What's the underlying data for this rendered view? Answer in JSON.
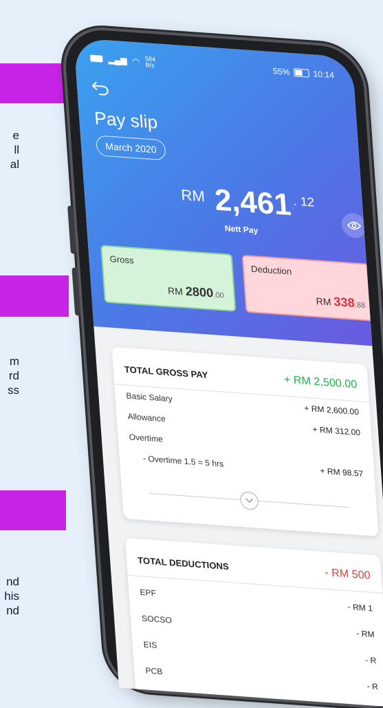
{
  "phone": {
    "status": {
      "speed_top": "584",
      "speed_bottom": "B/s",
      "battery": "55%",
      "time": "10:14"
    },
    "header": {
      "title": "Pay slip",
      "month": "March 2020"
    },
    "nett": {
      "currency": "RM",
      "whole": "2,461",
      "cents": ". 12",
      "label": "Nett Pay"
    },
    "gross_card": {
      "label": "Gross",
      "currency": "RM",
      "whole": "2800",
      "cents": ".00"
    },
    "deduction_card": {
      "label": "Deduction",
      "currency": "RM",
      "whole": "338",
      "cents": ".88"
    },
    "gross_panel": {
      "title": "TOTAL GROSS PAY",
      "total": "+ RM 2,500.00",
      "rows": [
        {
          "label": "Basic Salary",
          "amount": "+ RM 2,600.00"
        },
        {
          "label": "Allowance",
          "amount": "+ RM 312.00"
        },
        {
          "label": "Overtime",
          "amount": ""
        }
      ],
      "subrows": [
        {
          "label": "- Overtime 1.5 = 5 hrs",
          "amount": "+ RM 98.57"
        }
      ]
    },
    "deduction_panel": {
      "title": "TOTAL DEDUCTIONS",
      "total": "- RM 500",
      "rows": [
        {
          "label": "EPF",
          "amount": "- RM 1"
        },
        {
          "label": "SOCSO",
          "amount": "- RM"
        },
        {
          "label": "EIS",
          "amount": "- R"
        },
        {
          "label": "PCB",
          "amount": "- R"
        }
      ]
    },
    "colors": {
      "gross_green": "#22b14c",
      "deduction_red": "#e33d3d",
      "accent_magenta": "#c724e8"
    }
  },
  "background": {
    "frag1": [
      "e",
      "ll",
      "al"
    ],
    "frag2": [
      "m",
      "rd",
      "ss"
    ],
    "frag3": [
      "nd",
      "his",
      "nd"
    ]
  }
}
